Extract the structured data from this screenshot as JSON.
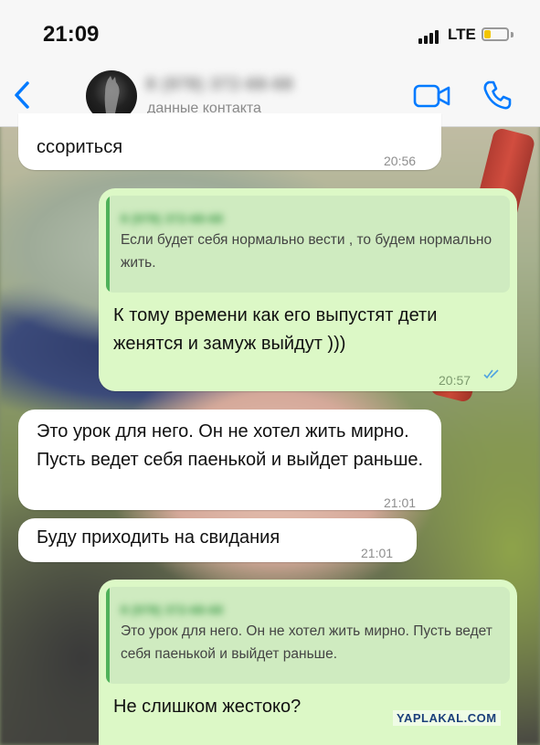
{
  "status_bar": {
    "time": "21:09",
    "network": "LTE",
    "battery_level": 0.2,
    "battery_color": "#f2c500"
  },
  "header": {
    "contact_name": "8 (978) 372-68-68",
    "contact_subtitle": "данные контакта",
    "accent_color": "#007aff",
    "icons": [
      "chevron-left-icon",
      "video-camera-icon",
      "phone-icon"
    ]
  },
  "messages": [
    {
      "direction": "in",
      "text": "ссориться",
      "time": "20:56"
    },
    {
      "direction": "out",
      "quote_author": "8 (978) 372-68-68",
      "quote_text": "Если будет себя нормально вести , то будем нормально жить.",
      "text": "К тому времени как его выпустят дети женятся и замуж выйдут )))",
      "time": "20:57",
      "status": "read"
    },
    {
      "direction": "in",
      "text": "Это урок для него. Он не хотел жить мирно. Пусть ведет себя паенькой и выйдет раньше.",
      "time": "21:01"
    },
    {
      "direction": "in",
      "text": "Буду приходить на свидания",
      "time": "21:01"
    },
    {
      "direction": "out",
      "quote_author": "8 (978) 372-68-68",
      "quote_text": "Это урок для него. Он не хотел жить мирно. Пусть ведет себя паенькой и выйдет раньше.",
      "text": "Не слишком жестоко?"
    }
  ],
  "watermark": "YAPLAKAL.COM"
}
